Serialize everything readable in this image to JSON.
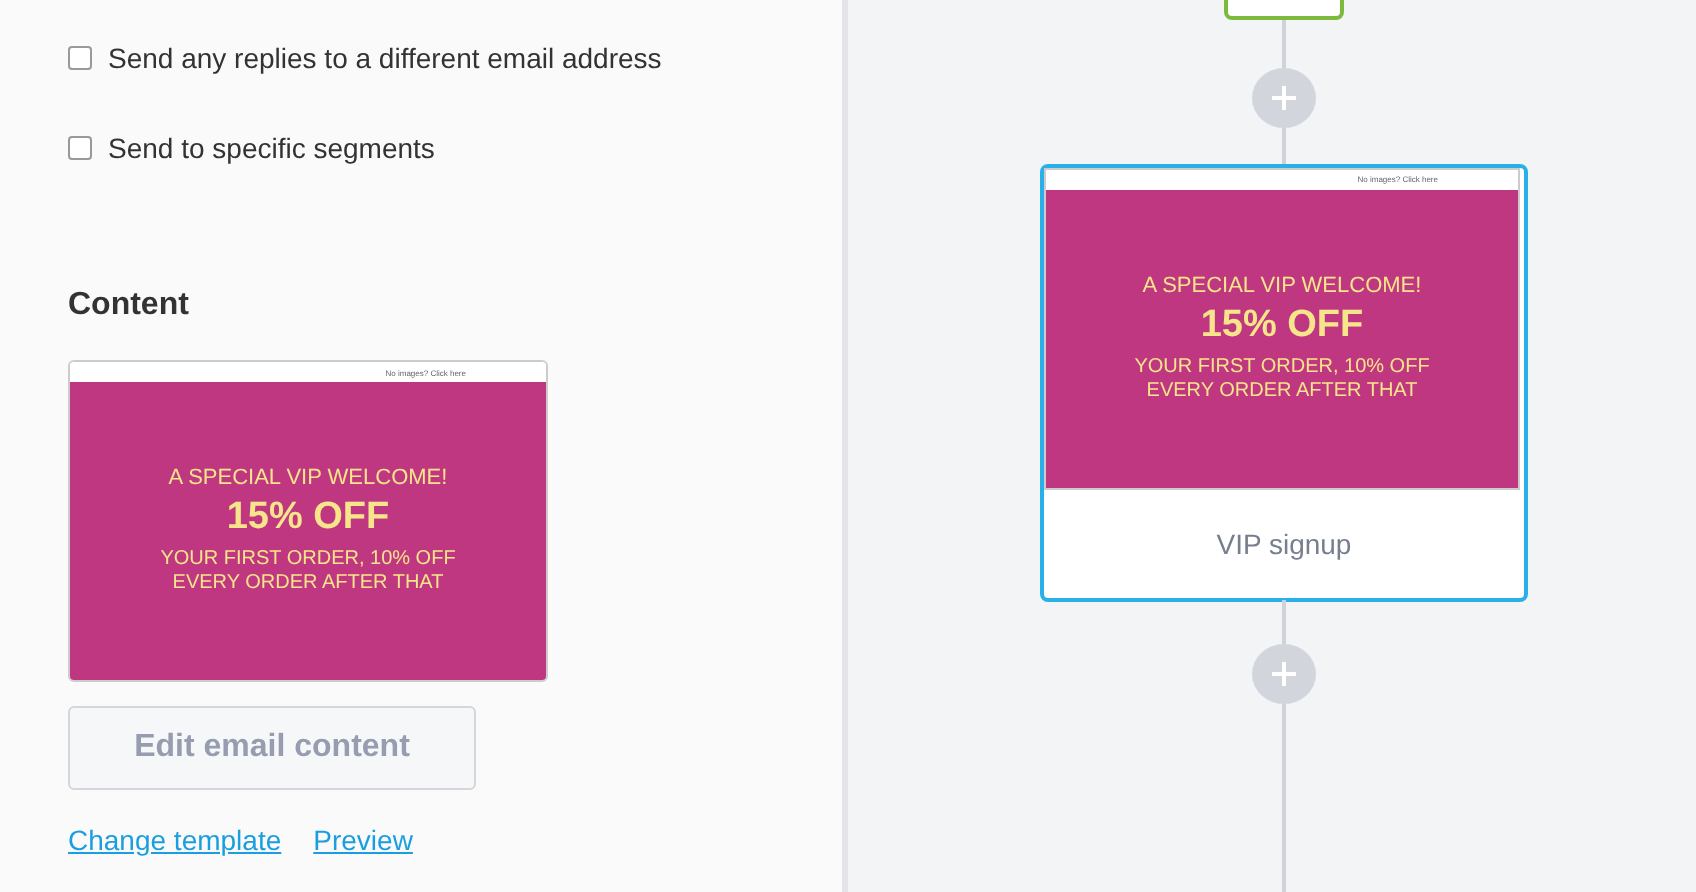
{
  "options": [
    {
      "label": "Send any replies to a different email address",
      "checked": false
    },
    {
      "label": "Send to specific segments",
      "checked": false
    }
  ],
  "content": {
    "heading": "Content",
    "email": {
      "topbar": "No images? Click here",
      "headline": "A SPECIAL VIP WELCOME!",
      "offer": "15% OFF",
      "details": [
        "YOUR FIRST ORDER, 10% OFF",
        "EVERY ORDER AFTER THAT"
      ]
    },
    "button": "Edit email content",
    "links": [
      "Change template",
      "Preview"
    ]
  },
  "flow": {
    "nodes": [
      {
        "kind": "condition"
      },
      {
        "kind": "add"
      },
      {
        "kind": "email",
        "selected": true,
        "label": "VIP signup",
        "email": {
          "topbar": "No images? Click here",
          "headline": "A SPECIAL VIP WELCOME!",
          "offer": "15% OFF",
          "details": [
            "YOUR FIRST ORDER, 10% OFF",
            "EVERY ORDER AFTER THAT"
          ]
        }
      },
      {
        "kind": "add"
      }
    ]
  }
}
